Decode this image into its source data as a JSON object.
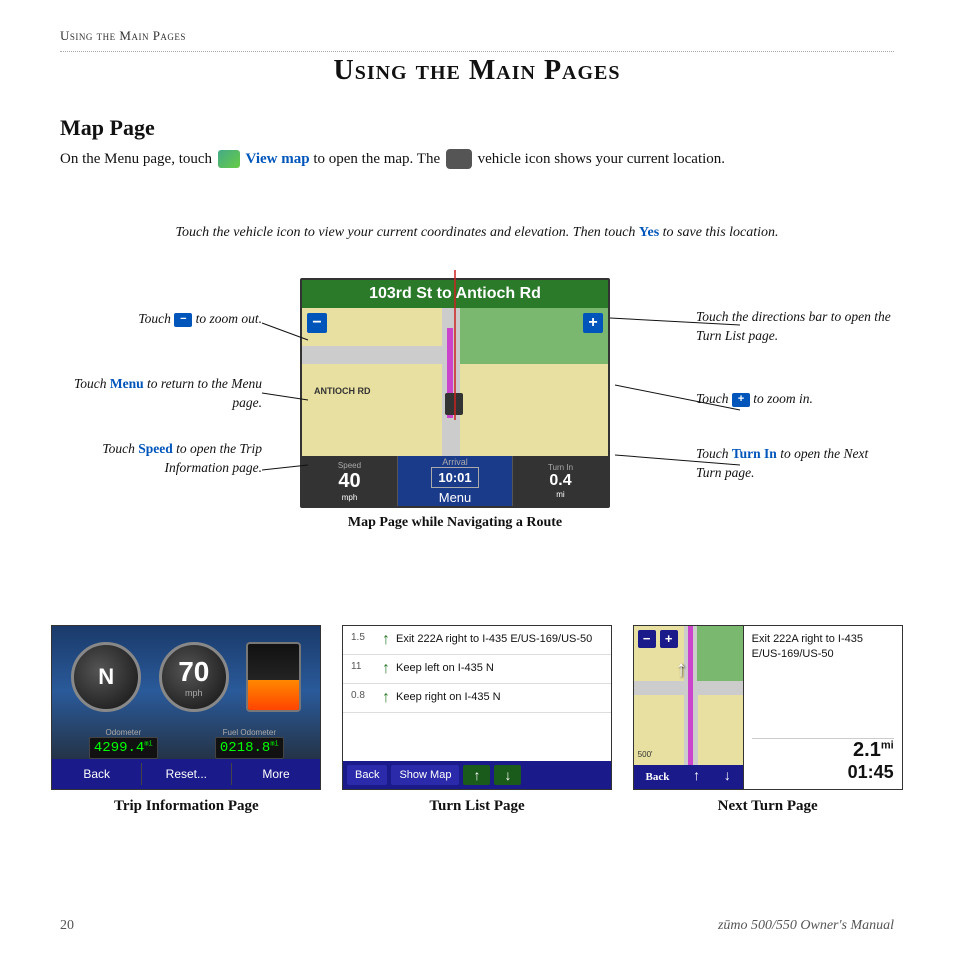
{
  "breadcrumb": "Using the Main Pages",
  "page_title": "Using the Main Pages",
  "section_heading": "Map Page",
  "intro": {
    "text1": "On the Menu page, touch",
    "link": "View map",
    "text2": "to open the map. The",
    "text3": "vehicle icon shows your current location."
  },
  "callout_top": {
    "text": "Touch the vehicle icon to view your current coordinates and elevation. Then touch",
    "yes": "Yes",
    "text2": "to save this location."
  },
  "annotations": {
    "zoom_out": "Touch",
    "zoom_out2": "to zoom out.",
    "menu": "Touch",
    "menu_link": "Menu",
    "menu2": "to return to the Menu page.",
    "speed": "Touch",
    "speed_link": "Speed",
    "speed2": "to open the Trip Information page.",
    "directions": "Touch the directions bar to open the Turn List page.",
    "zoom_in": "Touch",
    "zoom_in2": "to zoom in.",
    "turn_in": "Touch",
    "turn_in_link": "Turn In",
    "turn_in2": "to open the Next Turn page."
  },
  "map": {
    "title": "103rd St to Antioch Rd",
    "road_label": "ANTIOCH RD",
    "speed_label": "Speed",
    "speed_value": "40",
    "speed_unit": "mph",
    "arrival_label": "Arrival",
    "arrival_value": "10:01",
    "menu_label": "Menu",
    "turn_in_label": "Turn In",
    "turn_value": "0.4",
    "turn_unit": "mi"
  },
  "map_caption": "Map Page while Navigating a Route",
  "panels": [
    {
      "id": "trip",
      "label": "Trip Information Page",
      "speed": "70",
      "speed_unit": "mph",
      "compass": "N",
      "odometer_label": "Odometer",
      "odometer_value": "4299.4",
      "fuel_odo_label": "Fuel Odometer",
      "fuel_odo_value": "0218.8",
      "btn1": "Back",
      "btn2": "Reset...",
      "btn3": "More"
    },
    {
      "id": "turn_list",
      "label": "Turn List Page",
      "turns": [
        {
          "dist": "1.5",
          "text": "Exit 222A right to I-435 E/US-169/US-50"
        },
        {
          "dist": "11",
          "text": "Keep left on I-435 N"
        },
        {
          "dist": "0.8",
          "text": "Keep right on I-435 N"
        }
      ],
      "btn1": "Back",
      "btn2": "Show Map",
      "btn3": "↑",
      "btn4": "↓"
    },
    {
      "id": "next_turn",
      "label": "Next Turn Page",
      "turn_text": "Exit 222A right to I-435 E/US-169/US-50",
      "distance": "2.1",
      "distance_unit": "mi",
      "time": "01:45",
      "btn1": "Back",
      "btn2": "↑",
      "btn3": "↓"
    }
  ],
  "footer": {
    "page_number": "20",
    "manual": "zūmo 500/550 Owner's Manual"
  }
}
